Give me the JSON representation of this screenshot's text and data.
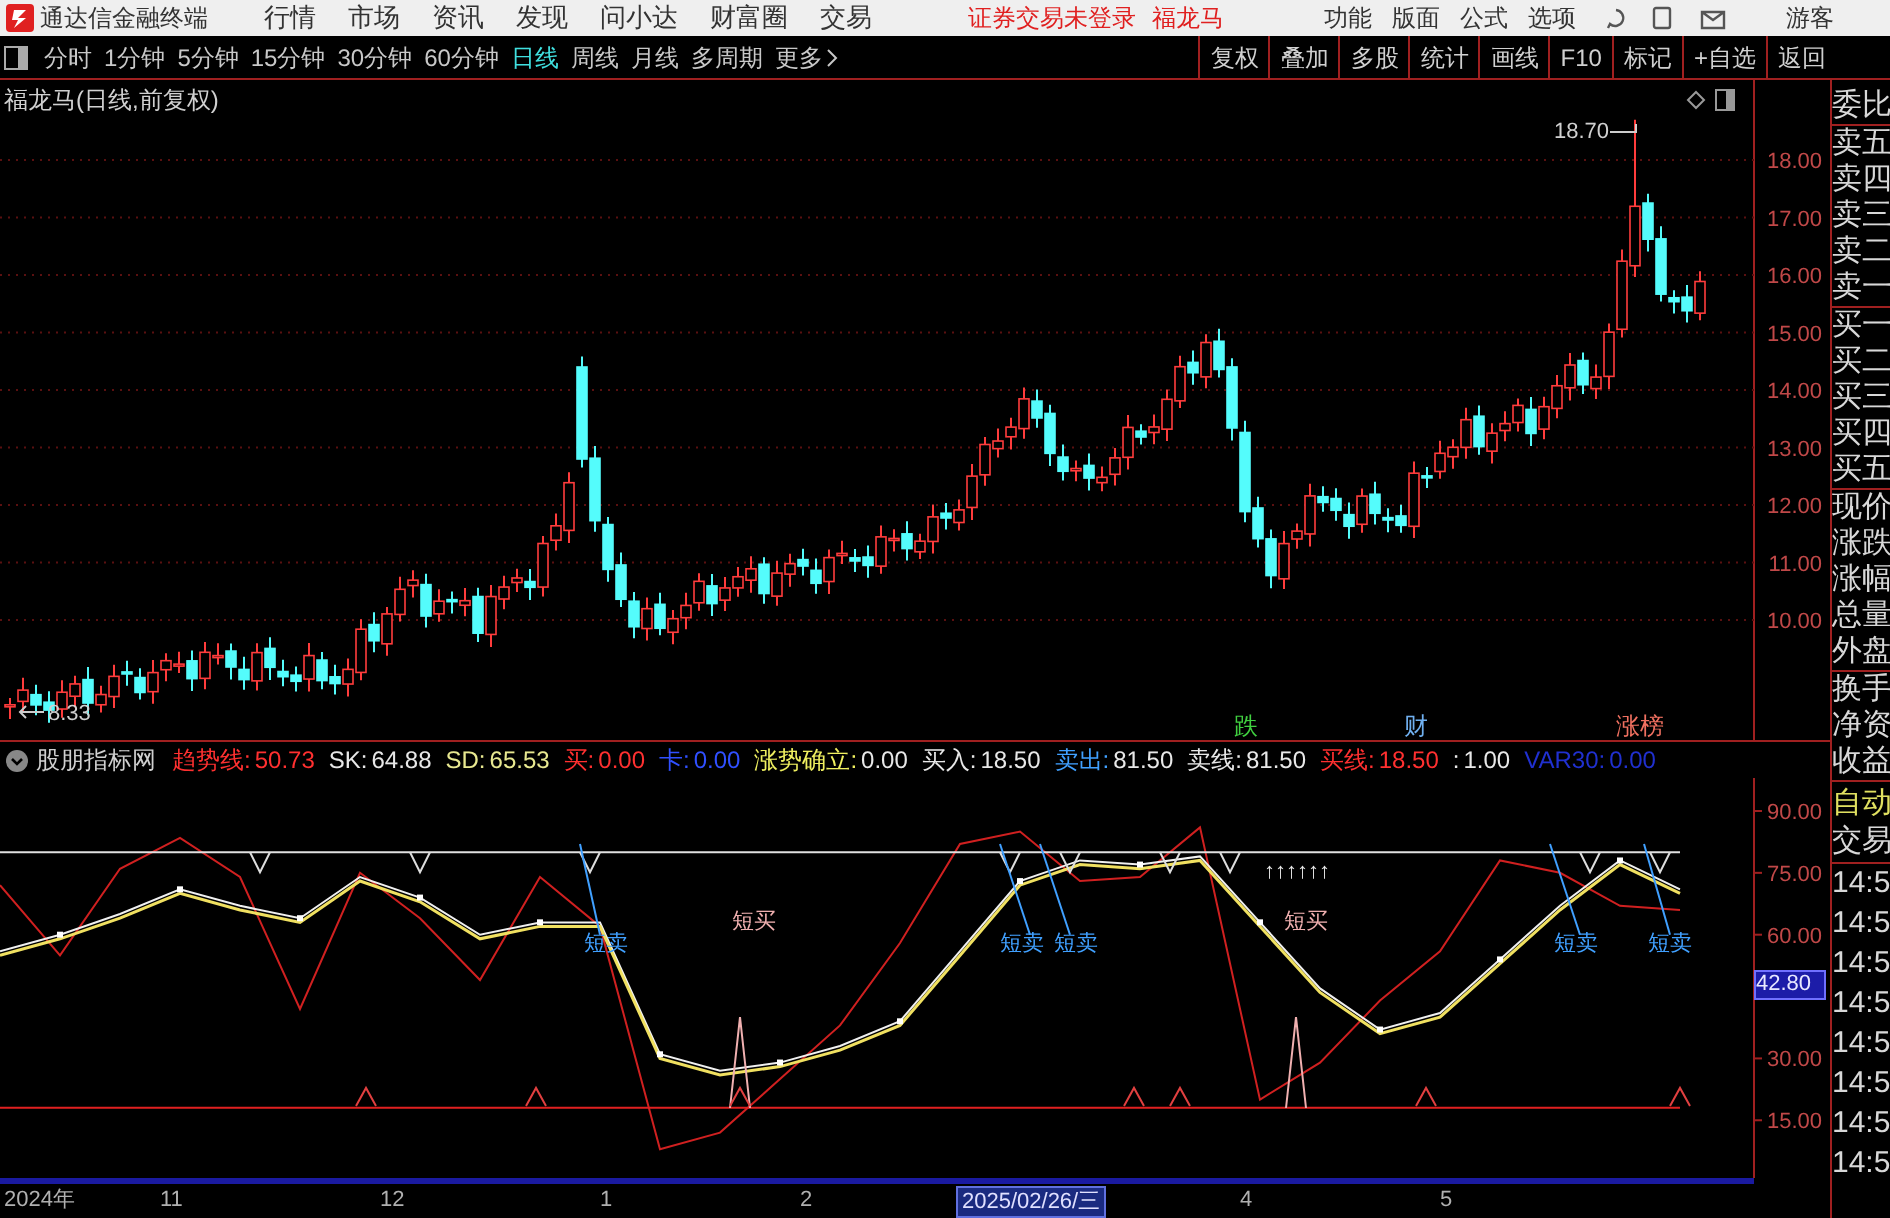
{
  "app": {
    "title": "通达信金融终端",
    "menu": [
      "行情",
      "市场",
      "资讯",
      "发现",
      "问小达",
      "财富圈",
      "交易"
    ],
    "notice": "证券交易未登录",
    "stock_name": "福龙马",
    "right_menu": [
      "功能",
      "版面",
      "公式",
      "选项"
    ],
    "user": "游客"
  },
  "periods": [
    {
      "label": "分时",
      "selected": false
    },
    {
      "label": "1分钟",
      "selected": false
    },
    {
      "label": "5分钟",
      "selected": false
    },
    {
      "label": "15分钟",
      "selected": false
    },
    {
      "label": "30分钟",
      "selected": false
    },
    {
      "label": "60分钟",
      "selected": false
    },
    {
      "label": "日线",
      "selected": true
    },
    {
      "label": "周线",
      "selected": false
    },
    {
      "label": "月线",
      "selected": false
    },
    {
      "label": "多周期",
      "selected": false
    },
    {
      "label": "更多",
      "selected": false
    }
  ],
  "tools": [
    "复权",
    "叠加",
    "多股",
    "统计",
    "画线",
    "F10",
    "标记",
    "+自选",
    "返回"
  ],
  "price_chart": {
    "title": "福龙马(日线,前复权)",
    "price_axis": [
      "18.00",
      "17.00",
      "16.00",
      "15.00",
      "14.00",
      "13.00",
      "12.00",
      "11.00",
      "10.00"
    ],
    "high_label": "18.70",
    "low_label": "8.33",
    "signals": [
      {
        "text": "跌",
        "color": "#40d040"
      },
      {
        "text": "财",
        "color": "#70b0f0"
      },
      {
        "text": "涨榜",
        "color": "#f07060"
      }
    ]
  },
  "indicator": {
    "name": "股朋指标网",
    "values": [
      {
        "text": "趋势线:",
        "color": "#ff3030"
      },
      {
        "text": "50.73",
        "color": "#ff3030"
      },
      {
        "text": "SK:",
        "color": "#e8e8e8"
      },
      {
        "text": "64.88",
        "color": "#e8e8e8"
      },
      {
        "text": "SD:",
        "color": "#e8e890"
      },
      {
        "text": "65.53",
        "color": "#e8e890"
      },
      {
        "text": "买:",
        "color": "#ff3030"
      },
      {
        "text": "0.00",
        "color": "#ff3030"
      },
      {
        "text": "卡:",
        "color": "#3050ff"
      },
      {
        "text": "0.00",
        "color": "#3050ff"
      },
      {
        "text": "涨势确立:",
        "color": "#f0f060"
      },
      {
        "text": "0.00",
        "color": "#e8e8e8"
      },
      {
        "text": "买入:",
        "color": "#e8e8e8"
      },
      {
        "text": "18.50",
        "color": "#e8e8e8"
      },
      {
        "text": "卖出:",
        "color": "#40a0ff"
      },
      {
        "text": "81.50",
        "color": "#e8e8e8"
      },
      {
        "text": "卖线:",
        "color": "#e8e8e8"
      },
      {
        "text": "81.50",
        "color": "#e8e8e8"
      },
      {
        "text": "买线:",
        "color": "#ff3030"
      },
      {
        "text": "18.50",
        "color": "#ff3030"
      },
      {
        "text": ":",
        "color": "#e8e8e8"
      },
      {
        "text": "1.00",
        "color": "#e8e8e8"
      },
      {
        "text": "VAR30:",
        "color": "#2030d0"
      },
      {
        "text": "0.00",
        "color": "#2030d0"
      }
    ],
    "chart_data": {
      "type": "line",
      "ylim": [
        1,
        98
      ],
      "yticks": [
        {
          "value": 90,
          "label": "90.00"
        },
        {
          "value": 75,
          "label": "75.00"
        },
        {
          "value": 60,
          "label": "60.00"
        },
        {
          "value": 30,
          "label": "30.00"
        },
        {
          "value": 15,
          "label": "15.00"
        }
      ],
      "series": [
        {
          "color": "#d02020",
          "values": [
            72,
            55,
            76,
            83.5,
            74,
            42,
            75,
            64,
            49,
            74,
            62,
            8,
            12,
            25,
            38,
            58,
            82,
            85,
            73,
            74,
            86,
            20,
            29,
            44,
            56,
            78,
            75,
            67,
            66
          ]
        },
        {
          "color": "#f0f0f0",
          "values": [
            56,
            60,
            65,
            71,
            67,
            64,
            74,
            69,
            60,
            63,
            63,
            31,
            27,
            29,
            33,
            39,
            56,
            73,
            78,
            77,
            79,
            63,
            47,
            37,
            41,
            54,
            67,
            78,
            71
          ]
        },
        {
          "color": "#f0e060",
          "values": [
            55,
            59,
            64,
            70,
            66,
            63,
            73,
            68,
            59,
            62,
            62,
            30,
            26,
            28,
            32,
            38,
            55,
            72,
            77,
            76,
            78,
            62,
            46,
            36,
            40,
            53,
            66,
            77,
            70
          ]
        },
        {
          "color": "#e0e0e0",
          "values": [
            80,
            80,
            80,
            80,
            80,
            80,
            80,
            80,
            80,
            80,
            80,
            80,
            80,
            80,
            80,
            80,
            80,
            80,
            80,
            80,
            80,
            80,
            80,
            80,
            80,
            80,
            80,
            80,
            80
          ]
        },
        {
          "color": "#e02020",
          "values": [
            18,
            18,
            18,
            18,
            18,
            18,
            18,
            18,
            18,
            18,
            18,
            18,
            18,
            18,
            18,
            18,
            18,
            18,
            18,
            18,
            18,
            18,
            18,
            18,
            18,
            18,
            18,
            18,
            18
          ]
        }
      ]
    },
    "current": "42.80",
    "annotations": [
      {
        "text": "短卖",
        "kind": "sell"
      },
      {
        "text": "短买",
        "kind": "buy"
      },
      {
        "text": "短卖",
        "kind": "sell"
      },
      {
        "text": "短卖",
        "kind": "sell"
      },
      {
        "text": "↑↑↑↑↑↑",
        "kind": "arrows"
      },
      {
        "text": "短买",
        "kind": "buy"
      },
      {
        "text": "短卖",
        "kind": "sell"
      },
      {
        "text": "短卖",
        "kind": "sell"
      }
    ]
  },
  "date_axis": [
    {
      "label": "2024年",
      "selected": false
    },
    {
      "label": "11",
      "selected": false
    },
    {
      "label": "12",
      "selected": false
    },
    {
      "label": "1",
      "selected": false
    },
    {
      "label": "2",
      "selected": false
    },
    {
      "label": "2025/02/26/三",
      "selected": true
    },
    {
      "label": "4",
      "selected": false
    },
    {
      "label": "5",
      "selected": false
    }
  ],
  "quote_panel": {
    "groups": [
      [
        "委比"
      ],
      [
        "卖五",
        "卖四",
        "卖三",
        "卖二",
        "卖一"
      ],
      [
        "买一",
        "买二",
        "买三",
        "买四",
        "买五"
      ],
      [
        "现价",
        "涨跌",
        "涨幅",
        "总量",
        "外盘"
      ],
      [
        "换手",
        "净资",
        "收益"
      ]
    ],
    "mode": "自动",
    "trade": "交易",
    "times": [
      "14:5",
      "14:5",
      "14:5",
      "14:5",
      "14:5",
      "14:5",
      "14:5",
      "14:5"
    ]
  }
}
